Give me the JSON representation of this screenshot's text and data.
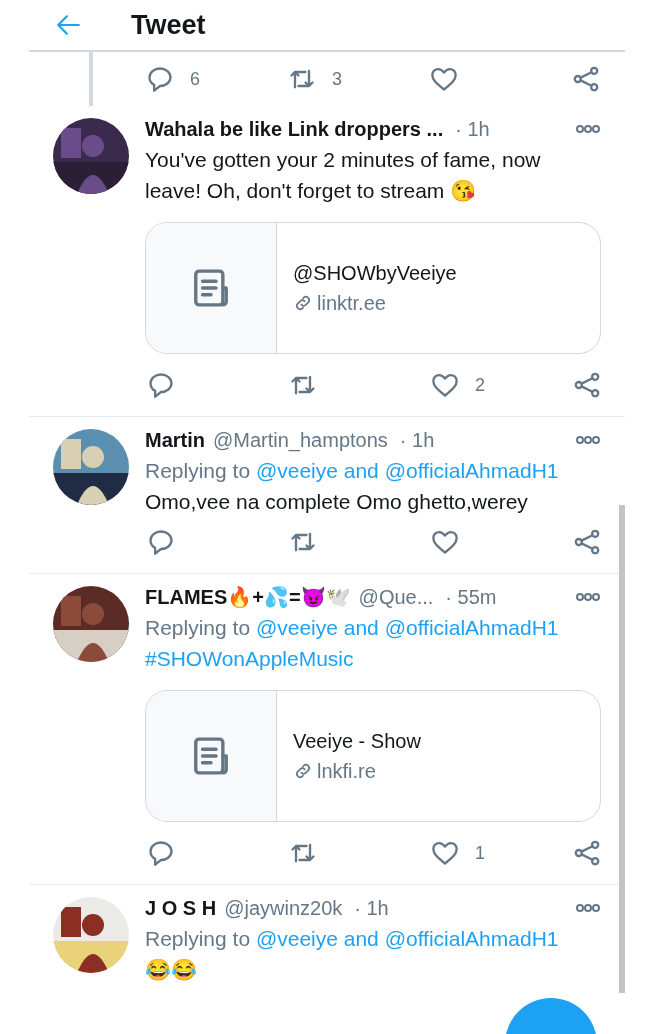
{
  "header": {
    "title": "Tweet"
  },
  "thread_actions": [
    {
      "kind": "reply",
      "count": "6"
    },
    {
      "kind": "retweet",
      "count": "3"
    },
    {
      "kind": "like"
    },
    {
      "kind": "share"
    }
  ],
  "tweets": [
    {
      "name": "Wahala be like Link droppers ...",
      "time": "· 1h",
      "body": "You've gotten your 2 minutes of fame, now leave! Oh, don't forget to stream 😘",
      "card": {
        "title": "@SHOWbyVeeiye",
        "domain": "linktr.ee"
      },
      "actions": [
        {
          "kind": "reply"
        },
        {
          "kind": "retweet"
        },
        {
          "kind": "like",
          "count": "2"
        },
        {
          "kind": "share"
        }
      ]
    },
    {
      "name": "Martin",
      "handle": "@Martin_hamptons",
      "time": "· 1h",
      "reply_prefix": "Replying to",
      "reply_to": "@veeiye and @officialAhmadH1",
      "body": "Omo,vee na complete Omo ghetto,werey",
      "actions": [
        {
          "kind": "reply"
        },
        {
          "kind": "retweet"
        },
        {
          "kind": "like"
        },
        {
          "kind": "share"
        }
      ]
    },
    {
      "name": "FLAMES🔥+💦=😈🕊️",
      "handle": "@Que...",
      "time": "· 55m",
      "reply_prefix": "Replying to",
      "reply_to": "@veeiye and @officialAhmadH1",
      "hashtag": "#SHOWonAppleMusic",
      "card": {
        "title": "Veeiye - Show",
        "domain": "lnkfi.re"
      },
      "actions": [
        {
          "kind": "reply"
        },
        {
          "kind": "retweet"
        },
        {
          "kind": "like",
          "count": "1"
        },
        {
          "kind": "share"
        }
      ]
    },
    {
      "name": "J O S H",
      "handle": "@jaywinz20k",
      "time": "· 1h",
      "reply_prefix": "Replying to",
      "reply_to": "@veeiye and @officialAhmadH1",
      "body": "😂😂"
    }
  ]
}
